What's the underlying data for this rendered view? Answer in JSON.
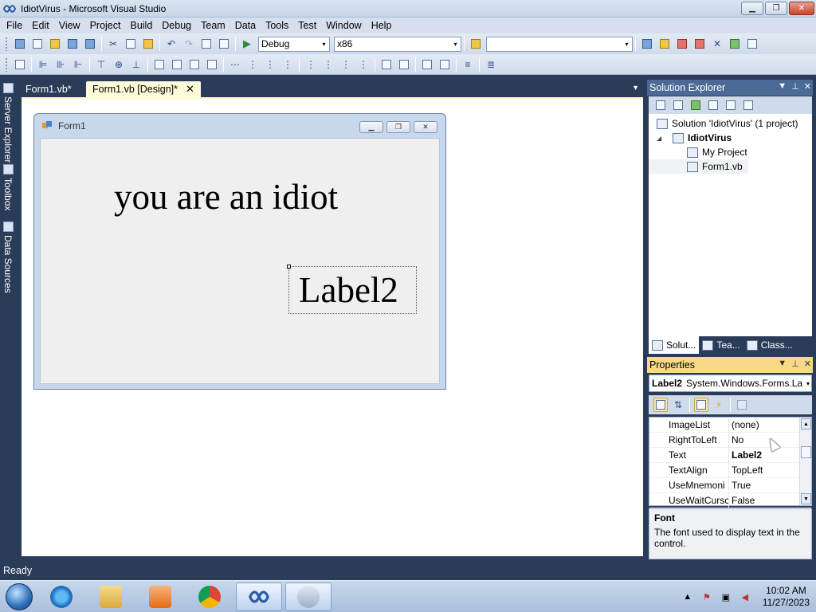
{
  "window": {
    "title": "IdiotVirus - Microsoft Visual Studio",
    "minimize_glyph": "▁",
    "restore_glyph": "❐",
    "close_glyph": "✕"
  },
  "menu": [
    "File",
    "Edit",
    "View",
    "Project",
    "Build",
    "Debug",
    "Team",
    "Data",
    "Tools",
    "Test",
    "Window",
    "Help"
  ],
  "toolbar": {
    "config_value": "Debug",
    "platform_value": "x86",
    "search_value": ""
  },
  "sidebar": {
    "server_explorer": "Server Explorer",
    "toolbox": "Toolbox",
    "data_sources": "Data Sources"
  },
  "tabs": {
    "code_tab": "Form1.vb*",
    "design_tab": "Form1.vb [Design]*",
    "close_glyph": "✕",
    "dropdown_glyph": "▼"
  },
  "form": {
    "title": "Form1",
    "label1_text": "you are an idiot",
    "label2_text": "Label2"
  },
  "solution_explorer": {
    "title": "Solution Explorer",
    "solution": "Solution 'IdiotVirus' (1 project)",
    "project": "IdiotVirus",
    "my_project": "My Project",
    "form_file": "Form1.vb",
    "tab_solution": "Solut...",
    "tab_team": "Tea...",
    "tab_class": "Class..."
  },
  "properties": {
    "title": "Properties",
    "object_name": "Label2",
    "object_type": "System.Windows.Forms.La",
    "rows": [
      {
        "name": "ImageList",
        "value": "(none)"
      },
      {
        "name": "RightToLeft",
        "value": "No"
      },
      {
        "name": "Text",
        "value": "Label2"
      },
      {
        "name": "TextAlign",
        "value": "TopLeft"
      },
      {
        "name": "UseMnemoni",
        "value": "True"
      },
      {
        "name": "UseWaitCursc",
        "value": "False"
      }
    ],
    "desc_title": "Font",
    "desc_text": "The font used to display text in the control."
  },
  "panel_buttons": {
    "menu_glyph": "▼",
    "pin_glyph": "⊥",
    "close_glyph": "✕"
  },
  "status": {
    "text": "Ready"
  },
  "taskbar": {
    "time": "10:02 AM",
    "date": "11/27/2023"
  },
  "icons": {
    "play": "▶",
    "dropdown": "▾"
  }
}
